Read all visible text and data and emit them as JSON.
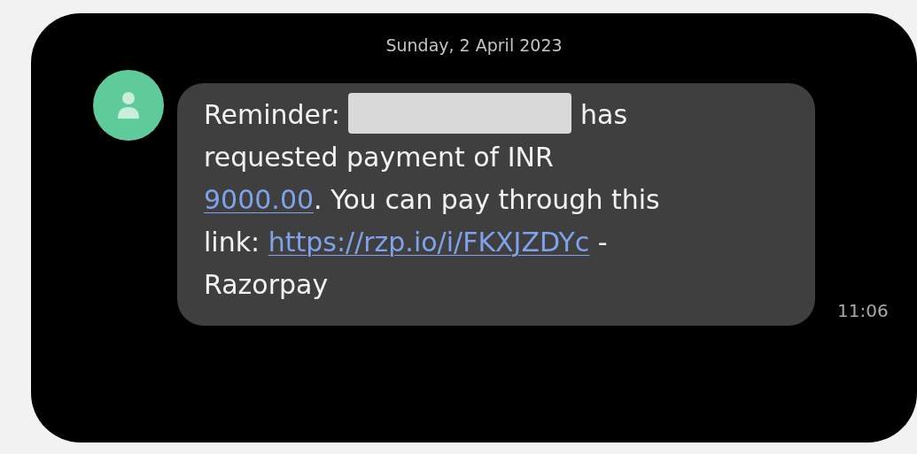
{
  "date_header": "Sunday, 2 April 2023",
  "message": {
    "segments": [
      {
        "kind": "text",
        "text": "Reminder: "
      },
      {
        "kind": "redaction"
      },
      {
        "kind": "text",
        "text": " has"
      },
      {
        "kind": "break"
      },
      {
        "kind": "text",
        "text": "requested payment of INR"
      },
      {
        "kind": "break"
      },
      {
        "kind": "link",
        "text": "9000.00"
      },
      {
        "kind": "text",
        "text": ". You can pay through this"
      },
      {
        "kind": "break"
      },
      {
        "kind": "text",
        "text": "link: "
      },
      {
        "kind": "link",
        "text": "https://rzp.io/i/FKXJZDYc"
      },
      {
        "kind": "text",
        "text": " -"
      },
      {
        "kind": "break"
      },
      {
        "kind": "text",
        "text": "Razorpay"
      }
    ],
    "time": "11:06"
  }
}
